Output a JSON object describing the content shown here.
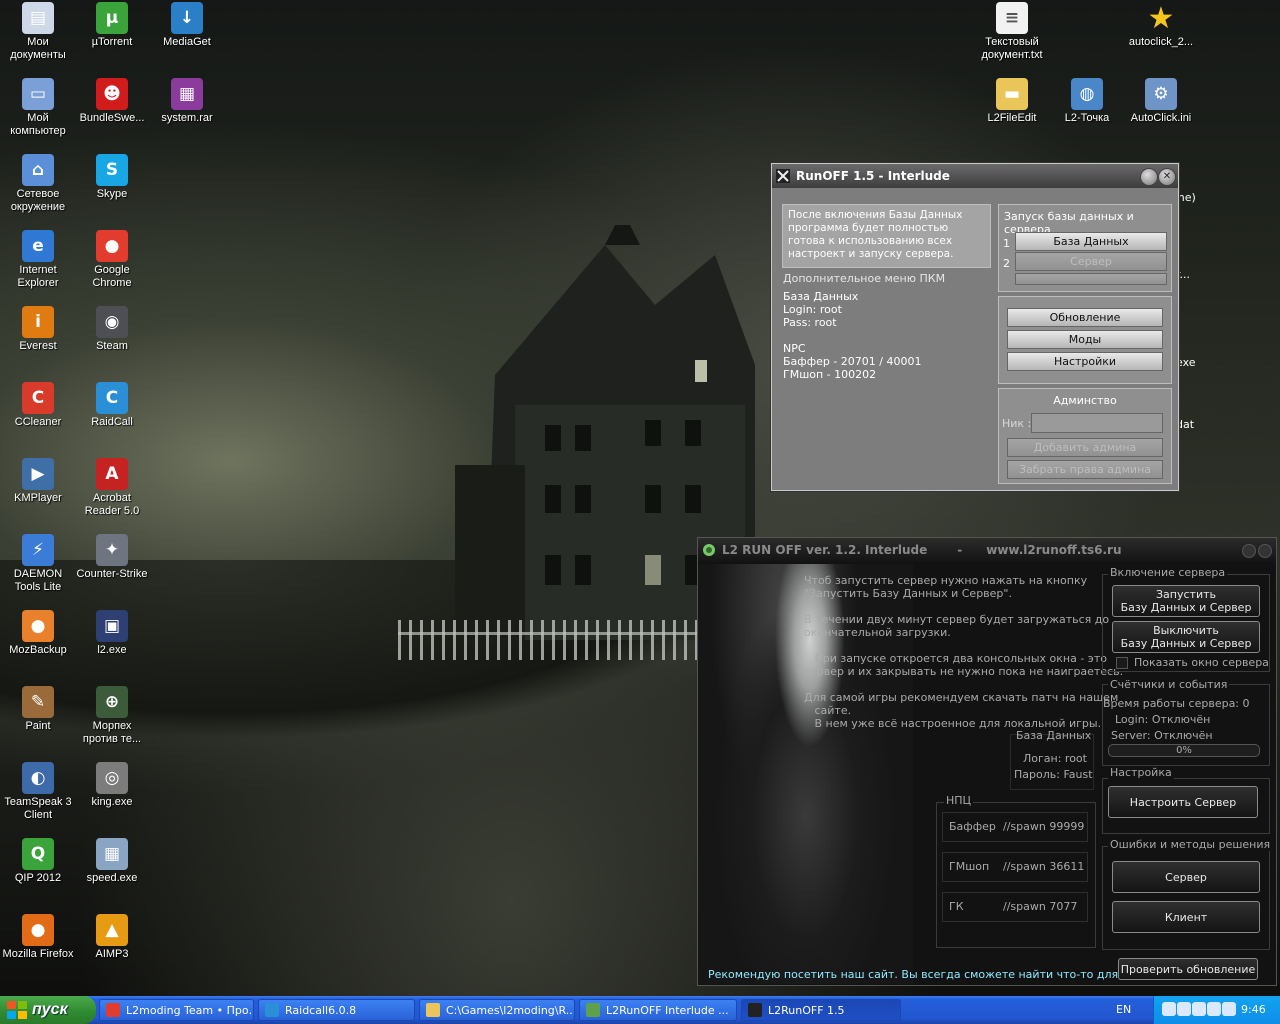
{
  "desktop": {
    "icons": [
      {
        "id": "my-documents",
        "label": "Мои документы",
        "icon": "folder-documents-icon",
        "color": "#cfd8e8"
      },
      {
        "id": "utorrent",
        "label": "µTorrent",
        "icon": "utorrent-icon",
        "color": "#3aa33a"
      },
      {
        "id": "mediaget",
        "label": "MediaGet",
        "icon": "mediaget-icon",
        "color": "#2b7fc7"
      },
      {
        "id": "my-computer",
        "label": "Мой компьютер",
        "icon": "computer-icon",
        "color": "#7ba0d8"
      },
      {
        "id": "bundleswe",
        "label": "BundleSwe...",
        "icon": "bundle-icon",
        "color": "#d21c1c"
      },
      {
        "id": "system-rar",
        "label": "system.rar",
        "icon": "rar-archive-icon",
        "color": "#8a3b9c"
      },
      {
        "id": "network",
        "label": "Сетевое окружение",
        "icon": "network-icon",
        "color": "#5b8fd8"
      },
      {
        "id": "skype",
        "label": "Skype",
        "icon": "skype-icon",
        "color": "#18a6e5"
      },
      {
        "id": "ie",
        "label": "Internet Explorer",
        "icon": "internet-explorer-icon",
        "color": "#2f79d5"
      },
      {
        "id": "chrome",
        "label": "Google Chrome",
        "icon": "chrome-icon",
        "color": "#e23c2f"
      },
      {
        "id": "everest",
        "label": "Everest",
        "icon": "everest-icon",
        "color": "#e07b12"
      },
      {
        "id": "steam",
        "label": "Steam",
        "icon": "steam-icon",
        "color": "#4d4f55"
      },
      {
        "id": "ccleaner",
        "label": "CCleaner",
        "icon": "ccleaner-icon",
        "color": "#d83b2a"
      },
      {
        "id": "raidcall",
        "label": "RaidCall",
        "icon": "raidcall-icon",
        "color": "#2a8fd6"
      },
      {
        "id": "kmplayer",
        "label": "KMPlayer",
        "icon": "kmplayer-icon",
        "color": "#3e6fa6"
      },
      {
        "id": "acrobat",
        "label": "Acrobat Reader 5.0",
        "icon": "acrobat-icon",
        "color": "#c62222"
      },
      {
        "id": "daemon",
        "label": "DAEMON Tools Lite",
        "icon": "daemon-tools-icon",
        "color": "#3b7cd6"
      },
      {
        "id": "counter-strike",
        "label": "Counter-Strike",
        "icon": "counter-strike-icon",
        "color": "#6e7480"
      },
      {
        "id": "mozbackup",
        "label": "MozBackup",
        "icon": "mozbackup-icon",
        "color": "#e8802c"
      },
      {
        "id": "l2-exe",
        "label": "l2.exe",
        "icon": "l2-exe-icon",
        "color": "#2e3f74"
      },
      {
        "id": "paint",
        "label": "Paint",
        "icon": "paint-icon",
        "color": "#9a6a3a"
      },
      {
        "id": "morpekh",
        "label": "Морпех против те...",
        "icon": "morpekh-icon",
        "color": "#3b5b3b"
      },
      {
        "id": "teamspeak",
        "label": "TeamSpeak 3 Client",
        "icon": "teamspeak-icon",
        "color": "#3d6aa8"
      },
      {
        "id": "king-exe",
        "label": "king.exe",
        "icon": "king-exe-icon",
        "color": "#7c7c7c"
      },
      {
        "id": "qip",
        "label": "QIP 2012",
        "icon": "qip-icon",
        "color": "#3aa33a"
      },
      {
        "id": "speed-exe",
        "label": "speed.exe",
        "icon": "speed-exe-icon",
        "color": "#8aa5c4"
      },
      {
        "id": "firefox",
        "label": "Mozilla Firefox",
        "icon": "firefox-icon",
        "color": "#e26b17"
      },
      {
        "id": "aimp3",
        "label": "AIMP3",
        "icon": "aimp-icon",
        "color": "#e69b12"
      },
      {
        "id": "text-doc",
        "label": "Текстовый документ.txt",
        "icon": "text-document-icon",
        "color": "#f2f2f2"
      },
      {
        "id": "autoclick-2",
        "label": "autoclick_2...",
        "icon": "star-icon",
        "color": "#f6c51e"
      },
      {
        "id": "l2fileedit",
        "label": "L2FileEdit",
        "icon": "folder-icon",
        "color": "#e9c55a"
      },
      {
        "id": "l2-tochka",
        "label": "L2-Точка",
        "icon": "l2-tochka-icon",
        "color": "#4a87c9"
      },
      {
        "id": "autoclick-ini",
        "label": "AutoClick.ini",
        "icon": "settings-file-icon",
        "color": "#6f94c7"
      }
    ],
    "partial_labels": [
      "me)",
      "r...",
      "exe",
      "dat"
    ]
  },
  "runoff": {
    "title": "RunOFF 1.5 - Interlude",
    "info_box": "После включения Базы Данных программа будет полностью готова к использованию всех настроект и запуску сервера.",
    "extra_menu_label": "Дополнительное меню ПКМ",
    "db_lines": [
      "База Данных",
      "Login: root",
      "Pass: root"
    ],
    "npc_lines": [
      "NPC",
      "Баффер - 20701 / 40001",
      "ГМшоп   - 100202"
    ],
    "launch_group_title": "Запуск базы данных и сервера",
    "step1": "1",
    "step2": "2",
    "db_button": "База Данных",
    "server_button": "Сервер",
    "update_button": "Обновление",
    "mods_button": "Моды",
    "settings_button": "Настройки",
    "admin_group_title": "Админство",
    "nick_label": "Ник :",
    "add_admin_button": "Добавить админа",
    "remove_admin_button": "Забрать права админа"
  },
  "l2runoff": {
    "title": "L2 RUN OFF ver. 1.2. Interlude",
    "title_sep": "-",
    "site": "www.l2runoff.ts6.ru",
    "info_lines": [
      "Чтоб запустить сервер нужно нажать на кнопку",
      "\"Запустить Базу Данных и Сервер\".",
      "",
      "В течении двух минут сервер будет загружаться до",
      "окончательной загрузки.",
      "",
      "   При запуске откроется два консольных окна - это",
      "сервер и их закрывать не нужно пока не наиграетесь.",
      "",
      "Для самой игры рекомендуем скачать патч на нашем",
      "   сайте.",
      "   В нем уже всё настроенное для локальной игры."
    ],
    "db_group_title": "База Данных",
    "db_login": "Логан: root",
    "db_pass": "Пароль: Faust",
    "npc_group_title": "НПЦ",
    "npc_rows": [
      {
        "name": "Баффер",
        "cmd": "//spawn 99999"
      },
      {
        "name": "ГМшоп",
        "cmd": "//spawn 36611"
      },
      {
        "name": "ГК",
        "cmd": "//spawn 7077"
      }
    ],
    "server_group_title": "Включение сервера",
    "start_button": "Запустить\nБазу Данных и Сервер",
    "stop_button": "Выключить\nБазу Данных и Сервер",
    "show_window_checkbox": "Показать окно сервера",
    "show_window_checked": false,
    "counters_group_title": "Счётчики и события",
    "uptime": "Время работы сервера: 0",
    "login_status": "Login:  Отключён",
    "server_status": "Server:  Отключён",
    "progress_label": "0%",
    "progress_value": 0,
    "setup_group_title": "Настройка",
    "configure_button": "Настроить Сервер",
    "errors_group_title": "Ошибки и методы решения",
    "server_help_button": "Сервер",
    "client_help_button": "Клиент",
    "footer_text": "Рекомендую посетить наш сайт. Вы всегда сможете найти что-то для сервера.",
    "check_update_button": "Проверить обновление",
    "accent_text_color": "#8fe9ff"
  },
  "taskbar": {
    "start_label": "пуск",
    "tasks": [
      {
        "label": "L2moding Team • Про...",
        "icon": "chrome-icon",
        "color": "#e23c2f",
        "active": false
      },
      {
        "label": "Raidcall6.0.8",
        "icon": "raidcall-icon",
        "color": "#2a8fd6",
        "active": false
      },
      {
        "label": "C:\\Games\\l2moding\\R...",
        "icon": "folder-icon",
        "color": "#e9c55a",
        "active": false
      },
      {
        "label": "L2RunOFF Interlude ...",
        "icon": "l2runoff-icon",
        "color": "#5fa04a",
        "active": false
      },
      {
        "label": "L2RunOFF 1.5",
        "icon": "runoff-icon",
        "color": "#222222",
        "active": true
      }
    ],
    "language": "EN",
    "clock": "9:46",
    "tray_icons": [
      "runoff-tray-icon",
      "skype-tray-icon",
      "raidcall-tray-icon",
      "volume-icon",
      "network-tray-icon"
    ]
  }
}
